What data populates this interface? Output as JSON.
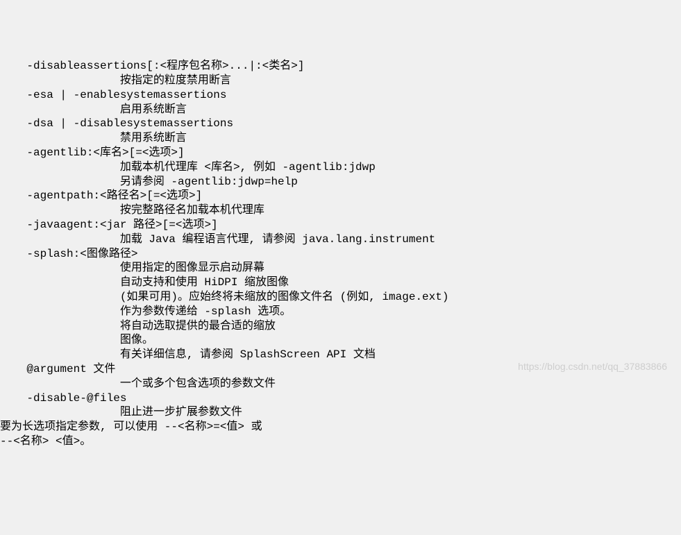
{
  "lines": [
    "    -disableassertions[:<程序包名称>...|:<类名>]",
    "                  按指定的粒度禁用断言",
    "    -esa | -enablesystemassertions",
    "                  启用系统断言",
    "    -dsa | -disablesystemassertions",
    "                  禁用系统断言",
    "    -agentlib:<库名>[=<选项>]",
    "                  加载本机代理库 <库名>, 例如 -agentlib:jdwp",
    "                  另请参阅 -agentlib:jdwp=help",
    "    -agentpath:<路径名>[=<选项>]",
    "                  按完整路径名加载本机代理库",
    "    -javaagent:<jar 路径>[=<选项>]",
    "                  加载 Java 编程语言代理, 请参阅 java.lang.instrument",
    "    -splash:<图像路径>",
    "                  使用指定的图像显示启动屏幕",
    "                  自动支持和使用 HiDPI 缩放图像",
    "                  (如果可用)。应始终将未缩放的图像文件名 (例如, image.ext)",
    "                  作为参数传递给 -splash 选项。",
    "                  将自动选取提供的最合适的缩放",
    "                  图像。",
    "                  有关详细信息, 请参阅 SplashScreen API 文档",
    "    @argument 文件",
    "                  一个或多个包含选项的参数文件",
    "    -disable-@files",
    "                  阻止进一步扩展参数文件",
    "要为长选项指定参数, 可以使用 --<名称>=<值> 或",
    "--<名称> <值>。"
  ],
  "watermark": "https://blog.csdn.net/qq_37883866"
}
